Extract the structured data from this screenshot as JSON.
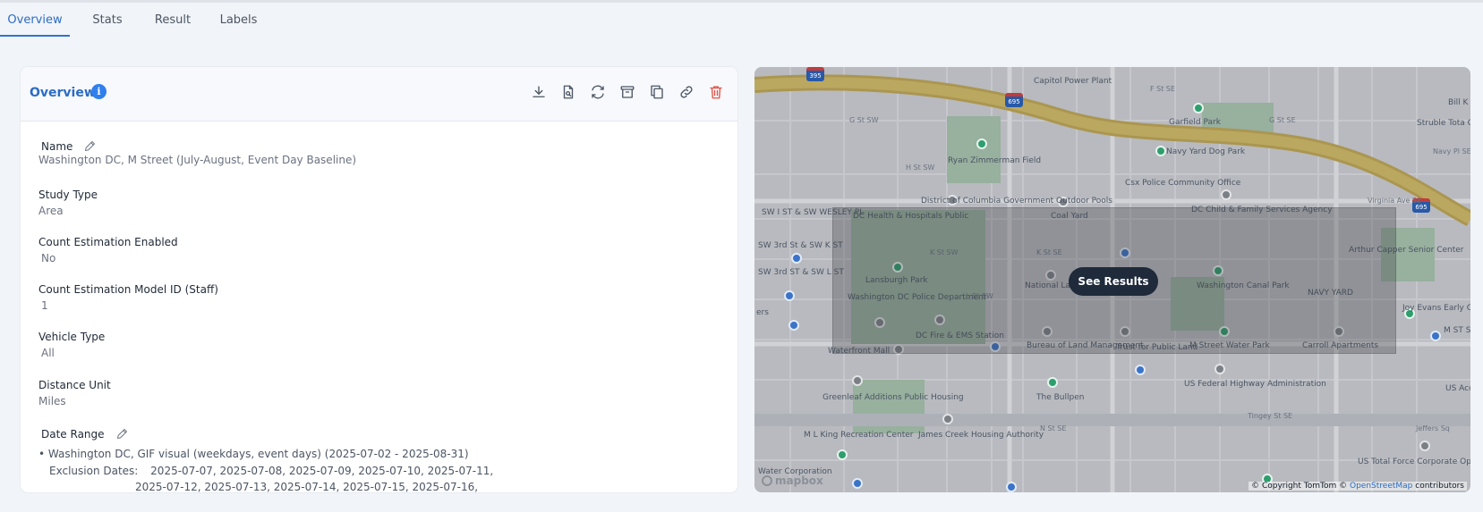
{
  "tabs": [
    {
      "label": "Overview",
      "active": true
    },
    {
      "label": "Stats",
      "active": false
    },
    {
      "label": "Result",
      "active": false
    },
    {
      "label": "Labels",
      "active": false
    }
  ],
  "overview": {
    "title": "Overview",
    "info_icon": "i",
    "actions": [
      "download-icon",
      "report-icon",
      "refresh-icon",
      "archive-icon",
      "copy-icon",
      "link-icon",
      "delete-icon"
    ],
    "fields": {
      "name": {
        "label": "Name",
        "value": "Washington DC, M Street (July-August, Event Day Baseline)"
      },
      "study_type": {
        "label": "Study Type",
        "value": "Area"
      },
      "count_estimation": {
        "label": "Count Estimation Enabled",
        "value": "No"
      },
      "model_id": {
        "label": "Count Estimation Model ID (Staff)",
        "value": "1"
      },
      "vehicle_type": {
        "label": "Vehicle Type",
        "value": "All"
      },
      "distance_unit": {
        "label": "Distance Unit",
        "value": "Miles"
      },
      "date_range": {
        "label": "Date Range",
        "item": "• Washington DC, GIF visual (weekdays, event days) (2025-07-02 - 2025-08-31)",
        "exclusion_label": "Exclusion Dates:",
        "exclusion_line1": "2025-07-07, 2025-07-08, 2025-07-09, 2025-07-10, 2025-07-11,",
        "exclusion_line2": "2025-07-12, 2025-07-13, 2025-07-14, 2025-07-15, 2025-07-16,"
      }
    }
  },
  "map": {
    "see_results_label": "See Results",
    "attribution_prefix": "© Copyright TomTom ©",
    "attribution_link": "OpenStreetMap",
    "attribution_suffix": "contributors",
    "logo_text": "mapbox",
    "shields": [
      "395",
      "695",
      "695"
    ],
    "labels": [
      "Capitol Power Plant",
      "F St SE",
      "G St SW",
      "Garfield Park",
      "G St SE",
      "Navy Yard Dog Park",
      "Ryan Zimmerman Field",
      "H St SW",
      "Csx Police Community Office",
      "District of Columbia Government Outdoor Pools",
      "DC Health & Hospitals Public",
      "Coal Yard",
      "DC Child & Family Services Agency",
      "SW I ST & SW WESLEY PL",
      "SW 3rd St & SW K ST",
      "K St SW",
      "K St SE",
      "Arthur Capper Senior Center",
      "SW 3rd ST & SW L ST",
      "Lansburgh Park",
      "National Labor Relations Board",
      "Washington Canal Park",
      "NAVY YARD",
      "Washington DC Police Department",
      "L St SW",
      "DC Fire & EMS Station",
      "Bureau of Land Management",
      "Trust for Public Land",
      "M Street Water Park",
      "Carroll Apartments",
      "Waterfront Mall",
      "US Federal Highway Administration",
      "Greenleaf Additions Public Housing",
      "The Bullpen",
      "Tingey St SE",
      "N St SE",
      "M L King Recreation Center",
      "James Creek Housing Authority",
      "US Total Force Corporate Operations",
      "Joy Evans Early Childhood Cen",
      "Struble Tota Communicatio",
      "Navy Pl SE",
      "Bill K",
      "Virginia Ave SE",
      "Jeffers Sq",
      "US Acc",
      "M ST SE",
      "Water Corporation",
      "ers"
    ]
  }
}
